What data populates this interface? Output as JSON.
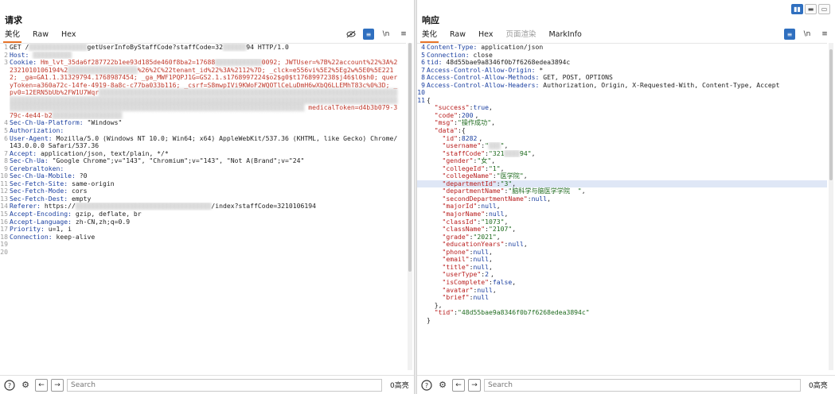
{
  "request": {
    "title": "请求",
    "tabs": [
      "美化",
      "Raw",
      "Hex"
    ],
    "icons": [
      "eye-slash-icon",
      "wrap-icon",
      "newline-icon",
      "menu-icon"
    ],
    "lines": [
      {
        "n": "1",
        "t": "GET /▒▒▒▒▒▒▒▒▒▒▒▒▒▒▒getUserInfoByStaffCode?staffCode=32▒▒▒▒▒▒94 HTTP/1.0"
      },
      {
        "n": "2",
        "t": "Host: ▒▒▒▒▒▒▒▒▒▒"
      },
      {
        "n": "3",
        "t": "Cookie: Hm_lvt_35da6f287722b1ee93d185de460f8ba2=17688▒▒▒▒▒▒▒▒▒▒▒▒0092; JWTUser=%7B%22account%22%3A%22321010106194%2▒▒▒▒▒▒▒▒▒▒▒▒▒▒▒▒▒▒%26%2C%22tenant_id%22%3A%2112%7D; _clck=e556vi%5E2%5Eg2w%5E0%5E2212; _ga=GA1.1.31329794.1768987454; _ga_MWF1PQPJ1G=GS2.1.s1768997224$o2$g0$t1768997238$j46$l0$h0; queryToken=a360a72c-14fe-4919-8a8c-c77ba033b116; _csrf=S8mwpIVi9KWoF2WQOTlCeLuDmH6wXbQ6LLEMhT83c%0%3D; _pv0=12ERN5bUb%2FW1U7Wqr▒▒▒▒▒▒▒▒▒▒▒▒▒▒▒▒▒▒▒▒▒▒▒▒▒▒▒▒▒▒▒▒▒▒▒▒▒▒▒▒▒▒▒▒▒▒▒▒▒▒▒▒▒▒▒▒▒▒▒▒▒▒▒▒▒▒▒▒▒▒▒▒▒▒▒▒▒▒▒▒▒▒▒▒▒▒▒▒▒▒▒▒▒▒▒▒▒▒▒▒▒▒▒▒▒▒▒▒▒▒▒▒▒▒▒▒▒▒▒▒▒▒▒▒▒▒▒▒▒▒▒▒▒▒▒▒▒▒▒▒▒▒▒▒▒▒▒▒▒▒▒▒▒▒▒▒▒▒▒▒▒▒▒▒▒▒▒▒▒▒▒▒▒▒▒▒▒▒▒▒▒▒▒▒▒▒▒▒▒▒▒▒▒▒▒▒▒▒▒▒▒▒▒▒▒▒▒▒▒▒▒▒▒▒▒▒▒▒▒▒▒▒▒▒▒▒▒▒▒▒▒▒▒▒▒▒▒▒▒▒▒▒▒▒▒▒▒▒▒▒▒▒▒ medicalToken=d4b3b079-379c-4e44-b2▒▒▒▒▒▒▒▒▒▒▒▒▒▒▒▒▒▒"
      },
      {
        "n": "4",
        "t": "Sec-Ch-Ua-Platform: \"Windows\""
      },
      {
        "n": "5",
        "t": "Authorization:"
      },
      {
        "n": "6",
        "t": "User-Agent: Mozilla/5.0 (Windows NT 10.0; Win64; x64) AppleWebKit/537.36 (KHTML, like Gecko) Chrome/143.0.0.0 Safari/537.36"
      },
      {
        "n": "7",
        "t": "Accept: application/json, text/plain, */*"
      },
      {
        "n": "8",
        "t": "Sec-Ch-Ua: \"Google Chrome\";v=\"143\", \"Chromium\";v=\"143\", \"Not A(Brand\";v=\"24\""
      },
      {
        "n": "9",
        "t": "Cerebraltoken:"
      },
      {
        "n": "10",
        "t": "Sec-Ch-Ua-Mobile: ?0"
      },
      {
        "n": "11",
        "t": "Sec-Fetch-Site: same-origin"
      },
      {
        "n": "12",
        "t": "Sec-Fetch-Mode: cors"
      },
      {
        "n": "13",
        "t": "Sec-Fetch-Dest: empty"
      },
      {
        "n": "14",
        "t": "Referer: https://▒▒▒▒▒▒▒▒▒▒▒▒▒▒▒▒▒▒▒▒▒▒▒▒▒▒▒▒▒▒▒▒▒▒▒/index?staffCode=3210106194"
      },
      {
        "n": "15",
        "t": "Accept-Encoding: gzip, deflate, br"
      },
      {
        "n": "16",
        "t": "Accept-Language: zh-CN,zh;q=0.9"
      },
      {
        "n": "17",
        "t": "Priority: u=1, i"
      },
      {
        "n": "18",
        "t": "Connection: keep-alive"
      },
      {
        "n": "19",
        "t": ""
      },
      {
        "n": "20",
        "t": ""
      }
    ],
    "footer": {
      "search_placeholder": "Search",
      "hits": "0高亮"
    }
  },
  "response": {
    "title": "响应",
    "tabs": [
      "美化",
      "Raw",
      "Hex",
      "页面渲染",
      "MarkInfo"
    ],
    "layout_toggles": [
      "split-columns-icon",
      "split-rows-icon",
      "single-pane-icon"
    ],
    "icons": [
      "wrap-icon",
      "newline-icon",
      "menu-icon"
    ],
    "headers": [
      {
        "n": "4",
        "t": "Content-Type: application/json"
      },
      {
        "n": "5",
        "t": "Connection: close"
      },
      {
        "n": "6",
        "t": "tid: 48d55bae9a8346f0b7f6268edea3894c"
      },
      {
        "n": "7",
        "t": "Access-Control-Allow-Origin: *"
      },
      {
        "n": "8",
        "t": "Access-Control-Allow-Methods: GET, POST, OPTIONS"
      },
      {
        "n": "9",
        "t": "Access-Control-Allow-Headers: Authorization, Origin, X-Requested-With, Content-Type, Accept"
      },
      {
        "n": "10",
        "t": ""
      }
    ],
    "json_lines": [
      {
        "n": "11",
        "t": "{"
      },
      {
        "n": "",
        "t": "  \"success\":true,"
      },
      {
        "n": "",
        "t": "  \"code\":200,"
      },
      {
        "n": "",
        "t": "  \"msg\":\"操作成功\","
      },
      {
        "n": "",
        "t": "  \"data\":{"
      },
      {
        "n": "",
        "t": "    \"id\":8282,"
      },
      {
        "n": "",
        "t": "    \"username\":\"▒▒▒\","
      },
      {
        "n": "",
        "t": "    \"staffCode\":\"321▒▒▒▒94\","
      },
      {
        "n": "",
        "t": "    \"gender\":\"女\","
      },
      {
        "n": "",
        "t": "    \"collegeId\":\"1\","
      },
      {
        "n": "",
        "t": "    \"collegeName\":\"医学院\","
      },
      {
        "n": "",
        "t": "    \"departmentId\":\"3\","
      },
      {
        "n": "",
        "t": "    \"departmentName\":\"脑科学与脑医学学院  \","
      },
      {
        "n": "",
        "t": "    \"secondDepartmentName\":null,"
      },
      {
        "n": "",
        "t": "    \"majorId\":null,"
      },
      {
        "n": "",
        "t": "    \"majorName\":null,"
      },
      {
        "n": "",
        "t": "    \"classId\":\"1073\","
      },
      {
        "n": "",
        "t": "    \"className\":\"2107\","
      },
      {
        "n": "",
        "t": "    \"grade\":\"2021\","
      },
      {
        "n": "",
        "t": "    \"educationYears\":null,"
      },
      {
        "n": "",
        "t": "    \"phone\":null,"
      },
      {
        "n": "",
        "t": "    \"email\":null,"
      },
      {
        "n": "",
        "t": "    \"title\":null,"
      },
      {
        "n": "",
        "t": "    \"userType\":2,"
      },
      {
        "n": "",
        "t": "    \"isComplete\":false,"
      },
      {
        "n": "",
        "t": "    \"avatar\":null,"
      },
      {
        "n": "",
        "t": "    \"brief\":null"
      },
      {
        "n": "",
        "t": "  },"
      },
      {
        "n": "",
        "t": "  \"tid\":\"48d55bae9a8346f0b7f6268edea3894c\""
      },
      {
        "n": "",
        "t": "}"
      }
    ],
    "footer": {
      "search_placeholder": "Search",
      "hits": "0高亮"
    }
  },
  "colors": {
    "accent_underline": "#e8752a",
    "toggle_blue": "#2f6fbf",
    "json_key": "#b81c1c",
    "json_string": "#1f6b1f",
    "header_name": "#1a3fa0"
  }
}
